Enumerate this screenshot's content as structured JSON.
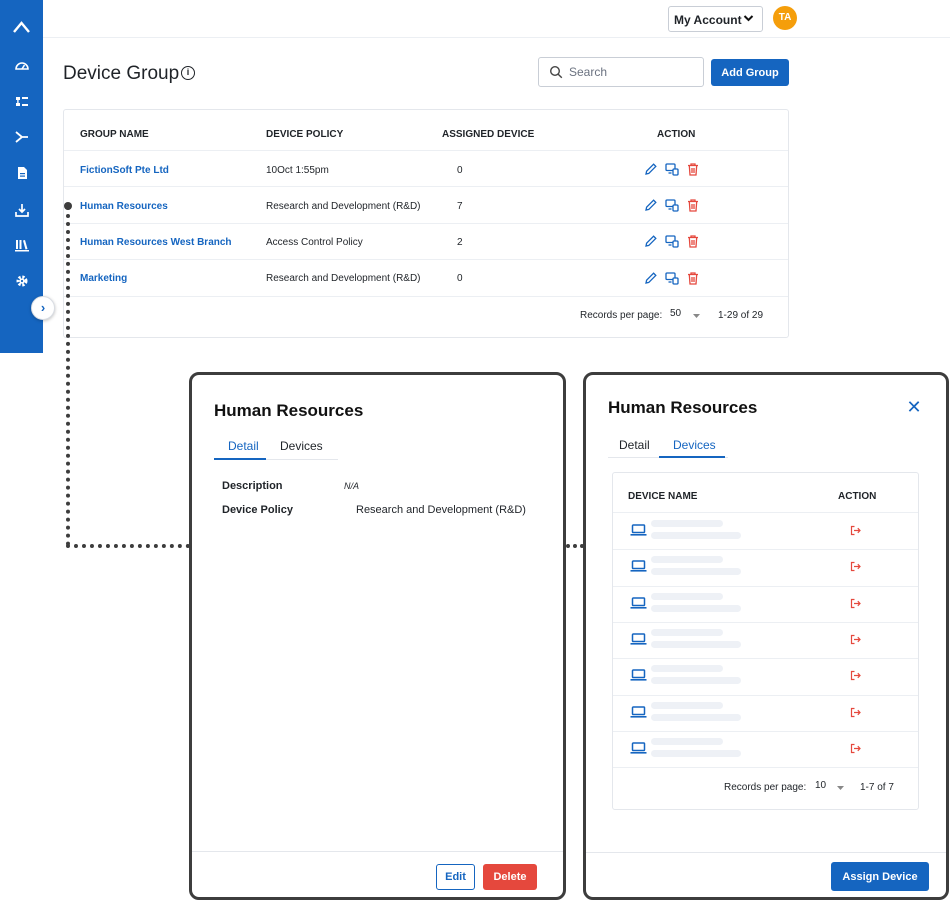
{
  "topbar": {
    "account_label": "My Account",
    "avatar_initials": "TA"
  },
  "header": {
    "title": "Device Group",
    "search_placeholder": "Search",
    "add_group_label": "Add Group"
  },
  "table": {
    "columns": [
      "GROUP NAME",
      "DEVICE POLICY",
      "ASSIGNED DEVICE",
      "ACTION"
    ],
    "rows": [
      {
        "group": "FictionSoft Pte Ltd",
        "policy": "10Oct 1:55pm",
        "assigned": "0"
      },
      {
        "group": "Human Resources",
        "policy": "Research and Development (R&D)",
        "assigned": "7"
      },
      {
        "group": "Human Resources West Branch",
        "policy": "Access Control Policy",
        "assigned": "2"
      },
      {
        "group": "Marketing",
        "policy": "Research and Development (R&D)",
        "assigned": "0"
      }
    ],
    "pager": {
      "label": "Records per page:",
      "per_page": "50",
      "range": "1-29 of 29"
    }
  },
  "detail_panel": {
    "title": "Human Resources",
    "tabs": [
      "Detail",
      "Devices"
    ],
    "active_tab": "Detail",
    "description_label": "Description",
    "description_value": "N/A",
    "policy_label": "Device Policy",
    "policy_value": "Research and Development (R&D)",
    "edit_label": "Edit",
    "delete_label": "Delete"
  },
  "devices_panel": {
    "title": "Human Resources",
    "tabs": [
      "Detail",
      "Devices"
    ],
    "active_tab": "Devices",
    "columns": [
      "DEVICE NAME",
      "ACTION"
    ],
    "device_count": 7,
    "pager": {
      "label": "Records per page:",
      "per_page": "10",
      "range": "1-7 of 7"
    },
    "assign_label": "Assign Device"
  },
  "colors": {
    "primary": "#1565c0",
    "danger": "#e5483d",
    "avatar": "#f59e0b",
    "frame": "#3d3d3d"
  }
}
